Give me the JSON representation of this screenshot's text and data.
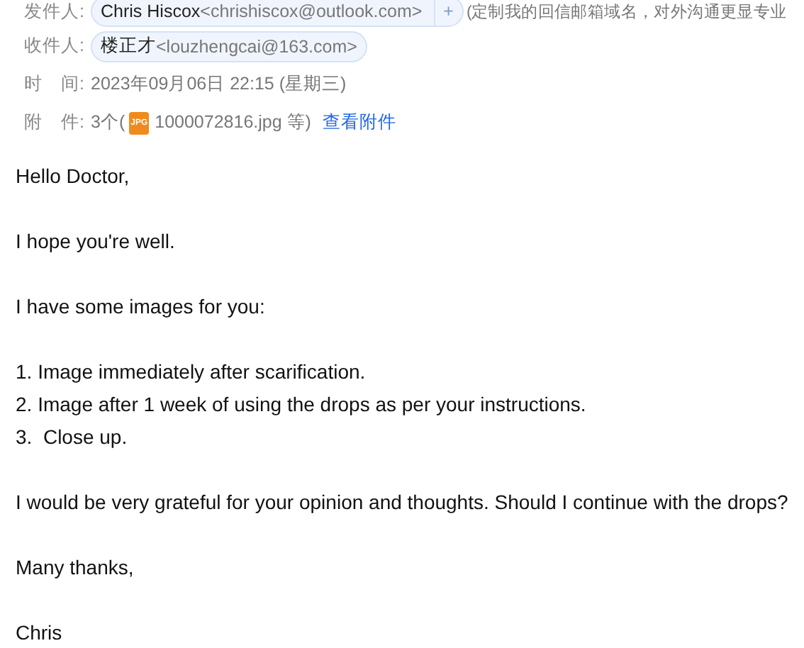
{
  "header": {
    "sender": {
      "label": "发件人:",
      "name": "Chris Hiscox",
      "address": "<chrishiscox@outlook.com>",
      "add": "+",
      "note": "(定制我的回信邮箱域名，对外沟通更显专业"
    },
    "recipient": {
      "label": "收件人:",
      "name": "楼正才",
      "address": "<louzhengcai@163.com>"
    },
    "time": {
      "label": "时　间:",
      "value": "2023年09月06日 22:15 (星期三)"
    },
    "attachments": {
      "label": "附　件:",
      "count": "3个(",
      "icon_text": "JPG",
      "file": "1000072816.jpg 等)",
      "link": "查看附件"
    }
  },
  "body": [
    [
      "Hello Doctor,"
    ],
    [
      "I hope you're well."
    ],
    [
      "I have some images for you:"
    ],
    [
      "1. Image immediately after scarification.",
      "2. Image after 1 week of using the drops as per your instructions.",
      "3.  Close up."
    ],
    [
      "I would be very grateful for your opinion and thoughts. Should I continue with the drops?"
    ],
    [
      "Many thanks,"
    ],
    [
      "Chris"
    ]
  ]
}
